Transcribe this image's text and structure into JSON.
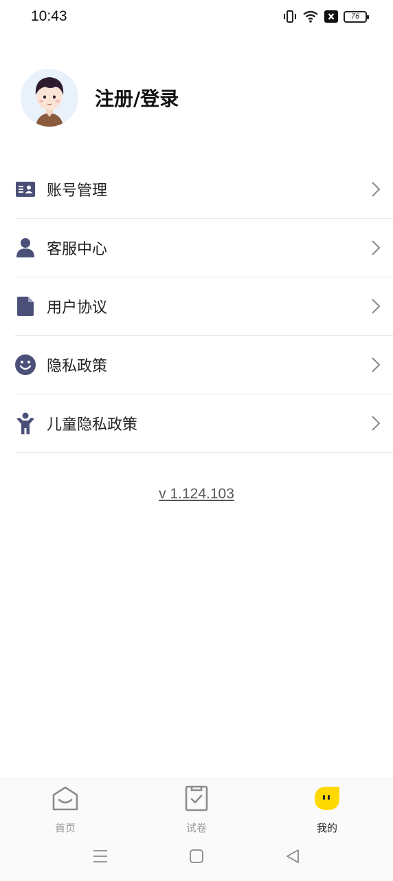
{
  "status_bar": {
    "time": "10:43",
    "battery": "76"
  },
  "profile": {
    "title": "注册/登录"
  },
  "menu": {
    "items": [
      {
        "label": "账号管理",
        "icon": "id-card-icon"
      },
      {
        "label": "客服中心",
        "icon": "person-icon"
      },
      {
        "label": "用户协议",
        "icon": "document-icon"
      },
      {
        "label": "隐私政策",
        "icon": "smiley-icon"
      },
      {
        "label": "儿童隐私政策",
        "icon": "child-icon"
      }
    ]
  },
  "version": "v 1.124.103",
  "tabs": [
    {
      "label": "首页",
      "icon": "home-icon",
      "active": false
    },
    {
      "label": "试卷",
      "icon": "exam-paper-icon",
      "active": false
    },
    {
      "label": "我的",
      "icon": "mine-icon",
      "active": true
    }
  ],
  "colors": {
    "icon": "#4a5078",
    "accent": "#ffd800",
    "divider": "#e8e8e8"
  }
}
